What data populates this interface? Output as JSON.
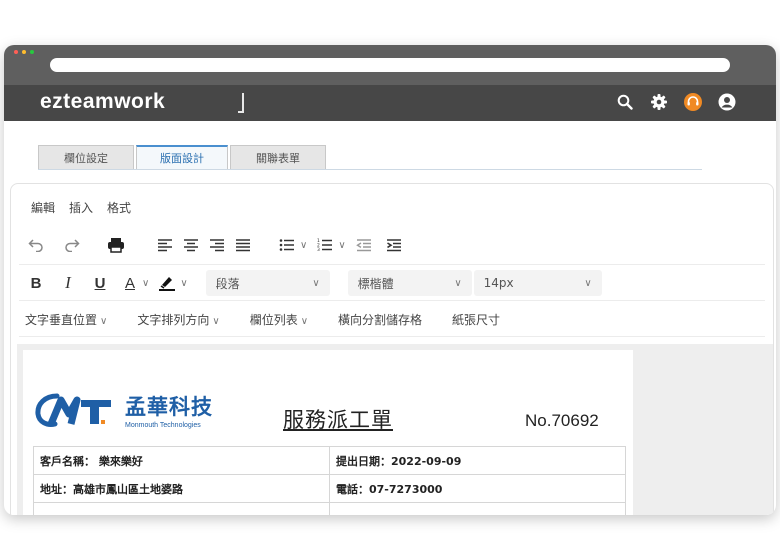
{
  "app": {
    "logo": "ezteamwork",
    "colors": {
      "chrome": "#5f5f5f",
      "appbar": "#474747",
      "dot_red": "#ff5f56",
      "dot_yellow": "#ffbd2e",
      "dot_green": "#27c93f",
      "accent_orange": "#f08a24",
      "brand_blue": "#1f5fa6"
    },
    "icons": [
      "search-icon",
      "gear-icon",
      "support-icon",
      "user-icon"
    ]
  },
  "tabs": [
    {
      "label": "欄位設定",
      "active": false
    },
    {
      "label": "版面設計",
      "active": true
    },
    {
      "label": "關聯表單",
      "active": false
    }
  ],
  "editor": {
    "menu": [
      "編輯",
      "插入",
      "格式"
    ],
    "toolbar1_icons": [
      "undo-icon",
      "redo-icon",
      "print-icon",
      "align-left-icon",
      "align-center-icon",
      "align-right-icon",
      "align-justify-icon",
      "bullet-list-icon",
      "numbered-list-icon",
      "outdent-icon",
      "indent-icon"
    ],
    "toolbar2": {
      "bold": "B",
      "italic": "I",
      "underline": "U",
      "font_color": "A",
      "block_select": "段落",
      "font_select": "標楷體",
      "size_select": "14px"
    },
    "toolbar3": [
      "文字垂直位置",
      "文字排列方向",
      "欄位列表",
      "橫向分割儲存格",
      "紙張尺寸"
    ]
  },
  "document": {
    "brand_cn": "孟華科技",
    "brand_en": "Monmouth Technologies",
    "title": "服務派工單",
    "number": "No.70692",
    "rows": [
      [
        "客戶名稱： 樂來樂好",
        "提出日期：2022-09-09"
      ],
      [
        "地址：高雄市鳳山區土地婆路",
        "電話：07-7273000"
      ]
    ]
  }
}
